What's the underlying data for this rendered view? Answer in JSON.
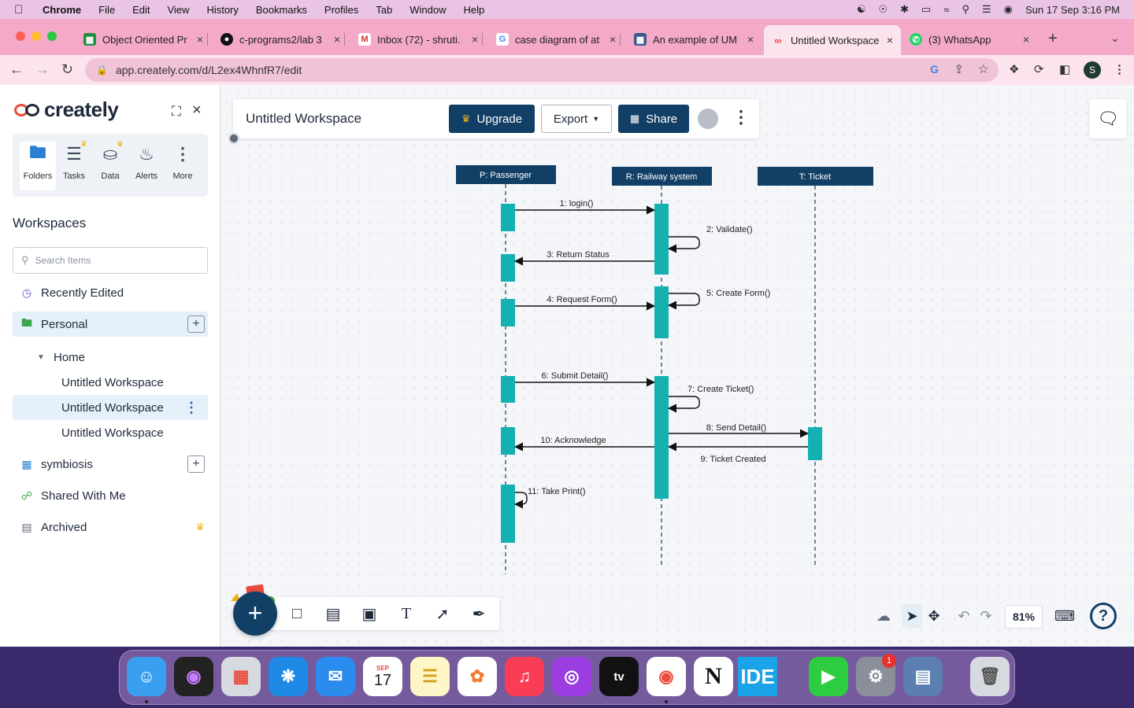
{
  "menubar": {
    "app": "Chrome",
    "items": [
      "File",
      "Edit",
      "View",
      "History",
      "Bookmarks",
      "Profiles",
      "Tab",
      "Window",
      "Help"
    ],
    "clock": "Sun 17 Sep  3:16 PM"
  },
  "tabs": [
    {
      "title": "Object Oriented Pro",
      "icon": "sheets-icon",
      "color": "#1e8e3e"
    },
    {
      "title": "c-programs2/lab 3",
      "icon": "github-icon",
      "color": "#111111"
    },
    {
      "title": "Inbox (72) - shruti.",
      "icon": "gmail-icon",
      "color": "#d93025"
    },
    {
      "title": "case diagram of atm",
      "icon": "google-icon",
      "color": "#4285f4"
    },
    {
      "title": "An example of UML",
      "icon": "uml-icon",
      "color": "#3a5a8a"
    },
    {
      "title": "Untitled Workspace",
      "icon": "creately-icon",
      "color": "#e94b3c"
    },
    {
      "title": "(3) WhatsApp",
      "icon": "whatsapp-icon",
      "color": "#25d366"
    }
  ],
  "address": {
    "url": "app.creately.com/d/L2ex4WhnfR7/edit",
    "profile_initial": "S"
  },
  "sidebar": {
    "brand": "creately",
    "tools": [
      {
        "label": "Folders",
        "icon": "folder-icon"
      },
      {
        "label": "Tasks",
        "icon": "tasks-icon"
      },
      {
        "label": "Data",
        "icon": "database-icon"
      },
      {
        "label": "Alerts",
        "icon": "bell-icon"
      },
      {
        "label": "More",
        "icon": "more-vertical-icon"
      }
    ],
    "workspaces_title": "Workspaces",
    "search_placeholder": "Search Items",
    "recently_edited": "Recently Edited",
    "personal": "Personal",
    "home": "Home",
    "home_items": [
      "Untitled Workspace",
      "Untitled Workspace",
      "Untitled Workspace"
    ],
    "symbiosis": "symbiosis",
    "shared": "Shared With Me",
    "archived": "Archived"
  },
  "header": {
    "title": "Untitled Workspace",
    "upgrade": "Upgrade",
    "export": "Export",
    "share": "Share"
  },
  "zoom": "81%",
  "diagram": {
    "lifelines": [
      {
        "label": "P: Passenger"
      },
      {
        "label": "R: Railway system"
      },
      {
        "label": "T: Ticket"
      }
    ],
    "messages": [
      "1: login()",
      "2: Validate()",
      "3: Return Status",
      "4: Request Form()",
      "5: Create Form()",
      "6: Submit Detail()",
      "7: Create Ticket()",
      "8: Send Detail()",
      "9: Ticket Created",
      "10: Acknowledge",
      "11: Take Print()"
    ],
    "colors": {
      "lifeline_head": "#123f66",
      "activation": "#14b1b3"
    }
  },
  "dock": {
    "calendar_month": "SEP",
    "calendar_day": "17",
    "facetime_badge": "1",
    "ide_label": "IDE"
  }
}
